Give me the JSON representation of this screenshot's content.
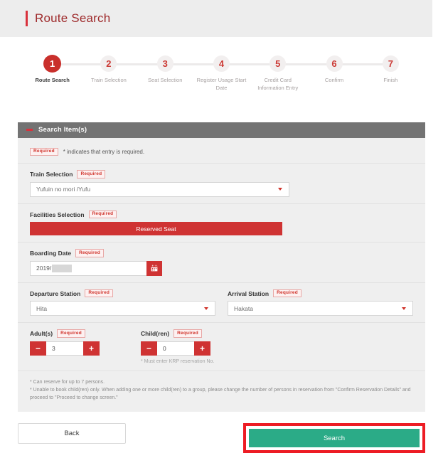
{
  "header": {
    "title": "Route Search"
  },
  "stepper": {
    "steps": [
      {
        "number": "1",
        "label": "Route Search",
        "active": true
      },
      {
        "number": "2",
        "label": "Train Selection",
        "active": false
      },
      {
        "number": "3",
        "label": "Seat Selection",
        "active": false
      },
      {
        "number": "4",
        "label": "Register Usage Start Date",
        "active": false
      },
      {
        "number": "5",
        "label": "Credit Card Information Entry",
        "active": false
      },
      {
        "number": "6",
        "label": "Confirm",
        "active": false
      },
      {
        "number": "7",
        "label": "Finish",
        "active": false
      }
    ]
  },
  "section": {
    "title": "Search Item(s)"
  },
  "required_note": {
    "badge": "Required",
    "text": "* indicates that entry is required."
  },
  "form": {
    "train_selection": {
      "label": "Train Selection",
      "badge": "Required",
      "value": "Yufuin no mori /Yufu"
    },
    "facilities_selection": {
      "label": "Facilities Selection",
      "badge": "Required",
      "value": "Reserved Seat"
    },
    "boarding_date": {
      "label": "Boarding Date",
      "badge": "Required",
      "value": "2019/",
      "calendar_icon": "calendar-icon"
    },
    "departure_station": {
      "label": "Departure Station",
      "badge": "Required",
      "value": "Hita"
    },
    "arrival_station": {
      "label": "Arrival Station",
      "badge": "Required",
      "value": "Hakata"
    },
    "adults": {
      "label": "Adult(s)",
      "badge": "Required",
      "value": "3",
      "minus": "−",
      "plus": "+"
    },
    "children": {
      "label": "Child(ren)",
      "badge": "Required",
      "value": "0",
      "minus": "−",
      "plus": "+",
      "note": "* Must enter KRP reservation No."
    }
  },
  "footnotes": {
    "line1": "* Can reserve for up to 7 persons.",
    "line2": "* Unable to book child(ren) only. When adding one or more child(ren) to a group, please change the number of persons in reservation from \"Confirm Reservation Details\" and proceed to \"Proceed to change screen.\""
  },
  "footer": {
    "back_label": "Back",
    "search_label": "Search"
  },
  "colors": {
    "brand_red": "#cf3333",
    "title_red": "#9e2a2b",
    "section_gray": "#737373",
    "panel_gray": "#efefef",
    "search_teal": "#2bab87",
    "highlight_red": "#ed1c24"
  }
}
